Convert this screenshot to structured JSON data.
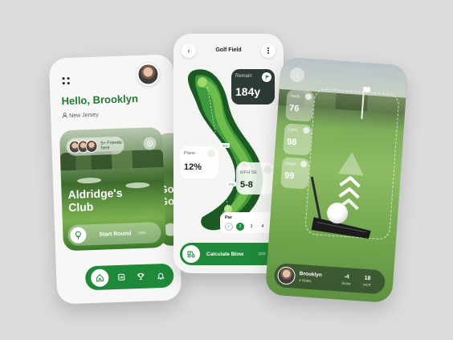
{
  "colors": {
    "accent": "#1e8a39",
    "background": "#dcdcdc",
    "card": "#f7f7f5",
    "dark_card": "#2d3a35"
  },
  "home": {
    "greeting": "Hello, Brooklyn",
    "location": "New Jersey",
    "friends_label": "5+ Friends here",
    "club_name": "Aldridge's Club",
    "start_label": "Start Round",
    "start_arrows": ">>>",
    "peek_club_name": "Gol Go",
    "nav": [
      "home-icon",
      "scorecard-icon",
      "trophy-icon",
      "bell-icon"
    ]
  },
  "field": {
    "title": "Golf Field",
    "remain_label": "Remain",
    "remain_value": "184y",
    "plane_label": "Plane",
    "plane_value": "12%",
    "wind_label": "MPH SE",
    "wind_value": "5-8",
    "par_label": "Par",
    "par_options": [
      "✓",
      "2",
      "3",
      "4"
    ],
    "par_selected": "2",
    "hole_distance_1": "18ey",
    "hole_distance_2": "22ey",
    "calc_label": "Calculate Blow",
    "calc_arrows": ">>>"
  },
  "putt": {
    "stats": [
      {
        "label": "Yards",
        "value": "76"
      },
      {
        "label": "Carry",
        "value": "98"
      },
      {
        "label": "Angle",
        "value": "99"
      }
    ],
    "player_name": "Brooklyn",
    "player_sub": "4 Holes",
    "score_value": "-4",
    "score_label": "Score",
    "hcp_value": "18",
    "hcp_label": "HCP"
  }
}
